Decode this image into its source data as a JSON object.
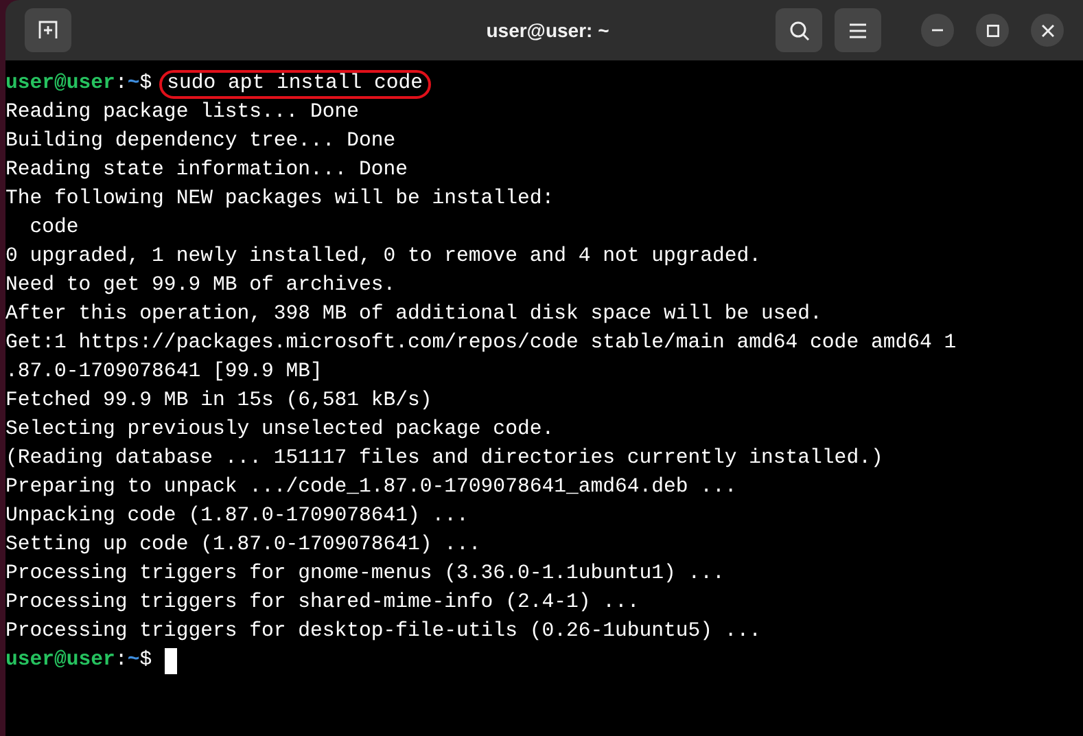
{
  "window": {
    "title": "user@user: ~"
  },
  "lines": [
    {
      "kind": "prompt",
      "user": "user@user",
      "separator": ":",
      "path": "~",
      "symbol": "$",
      "command": "sudo apt install code",
      "highlighted": true
    },
    {
      "kind": "output",
      "text": "Reading package lists... Done"
    },
    {
      "kind": "output",
      "text": "Building dependency tree... Done"
    },
    {
      "kind": "output",
      "text": "Reading state information... Done"
    },
    {
      "kind": "output",
      "text": "The following NEW packages will be installed:"
    },
    {
      "kind": "output",
      "text": "  code"
    },
    {
      "kind": "output",
      "text": "0 upgraded, 1 newly installed, 0 to remove and 4 not upgraded."
    },
    {
      "kind": "output",
      "text": "Need to get 99.9 MB of archives."
    },
    {
      "kind": "output",
      "text": "After this operation, 398 MB of additional disk space will be used."
    },
    {
      "kind": "output",
      "text": "Get:1 https://packages.microsoft.com/repos/code stable/main amd64 code amd64 1"
    },
    {
      "kind": "output",
      "text": ".87.0-1709078641 [99.9 MB]"
    },
    {
      "kind": "output",
      "text": "Fetched 99.9 MB in 15s (6,581 kB/s)"
    },
    {
      "kind": "output",
      "text": "Selecting previously unselected package code."
    },
    {
      "kind": "output",
      "text": "(Reading database ... 151117 files and directories currently installed.)"
    },
    {
      "kind": "output",
      "text": "Preparing to unpack .../code_1.87.0-1709078641_amd64.deb ..."
    },
    {
      "kind": "output",
      "text": "Unpacking code (1.87.0-1709078641) ..."
    },
    {
      "kind": "output",
      "text": "Setting up code (1.87.0-1709078641) ..."
    },
    {
      "kind": "output",
      "text": "Processing triggers for gnome-menus (3.36.0-1.1ubuntu1) ..."
    },
    {
      "kind": "output",
      "text": "Processing triggers for shared-mime-info (2.4-1) ..."
    },
    {
      "kind": "output",
      "text": "Processing triggers for desktop-file-utils (0.26-1ubuntu5) ..."
    },
    {
      "kind": "prompt",
      "user": "user@user",
      "separator": ":",
      "path": "~",
      "symbol": "$",
      "cursor": true
    }
  ]
}
